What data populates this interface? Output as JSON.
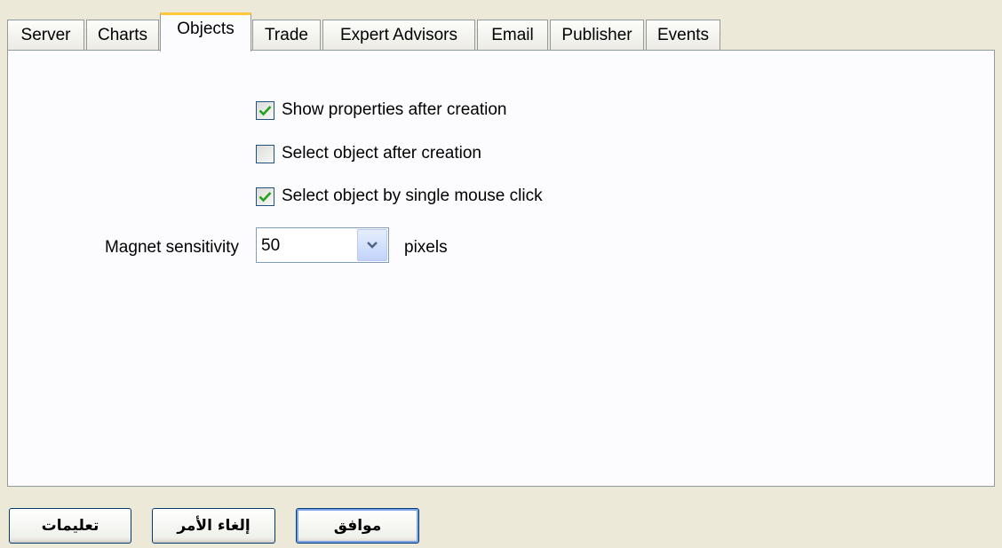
{
  "tabs": [
    {
      "label": "Server",
      "active": false
    },
    {
      "label": "Charts",
      "active": false
    },
    {
      "label": "Objects",
      "active": true
    },
    {
      "label": "Trade",
      "active": false
    },
    {
      "label": "Expert Advisors",
      "active": false
    },
    {
      "label": "Email",
      "active": false
    },
    {
      "label": "Publisher",
      "active": false
    },
    {
      "label": "Events",
      "active": false
    }
  ],
  "objects": {
    "show_properties": {
      "label": "Show properties after creation",
      "checked": true
    },
    "select_after_creation": {
      "label": "Select object after creation",
      "checked": false
    },
    "select_single_click": {
      "label": "Select object by single mouse click",
      "checked": true
    },
    "magnet": {
      "label": "Magnet sensitivity",
      "value": "50",
      "unit": "pixels"
    }
  },
  "buttons": {
    "help": "تعليمات",
    "cancel": "إلغاء الأمر",
    "ok": "موافق"
  },
  "colors": {
    "check": "#21a121",
    "active_tab_accent": "#ffc83c",
    "button_border": "#003c74"
  }
}
